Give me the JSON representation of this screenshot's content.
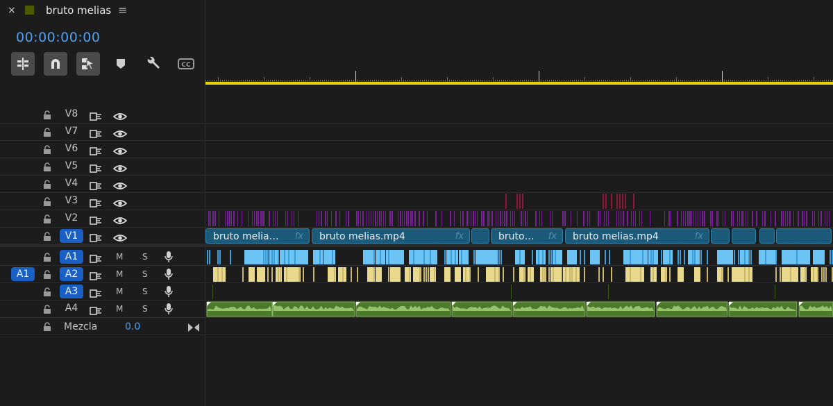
{
  "tab": {
    "close": "×",
    "title": "bruto melias",
    "menu": "≡",
    "swatch_color": "#4d5b00"
  },
  "timecode": "00:00:00:00",
  "toolbar": [
    {
      "name": "insert-nest-icon",
      "boxed": true
    },
    {
      "name": "snap-magnet-icon",
      "boxed": true
    },
    {
      "name": "linked-selection-icon",
      "boxed": true
    },
    {
      "name": "add-marker-icon",
      "boxed": false
    },
    {
      "name": "wrench-icon",
      "boxed": false
    },
    {
      "name": "captions-icon",
      "boxed": false
    }
  ],
  "tracks": {
    "video": [
      {
        "name": "V8",
        "source": "",
        "active": false
      },
      {
        "name": "V7",
        "source": "",
        "active": false
      },
      {
        "name": "V6",
        "source": "",
        "active": false
      },
      {
        "name": "V5",
        "source": "",
        "active": false
      },
      {
        "name": "V4",
        "source": "",
        "active": false
      },
      {
        "name": "V3",
        "source": "",
        "active": false
      },
      {
        "name": "V2",
        "source": "",
        "active": false
      },
      {
        "name": "V1",
        "source": "",
        "active": true
      }
    ],
    "audio": [
      {
        "name": "A1",
        "source": "",
        "active": true,
        "m": "M",
        "s": "S"
      },
      {
        "name": "A2",
        "source": "A1",
        "active": true,
        "m": "M",
        "s": "S"
      },
      {
        "name": "A3",
        "source": "",
        "active": true,
        "m": "M",
        "s": "S"
      },
      {
        "name": "A4",
        "source": "",
        "active": false,
        "m": "M",
        "s": "S"
      }
    ]
  },
  "mix": {
    "label": "Mezcla",
    "value": "0.0"
  },
  "v1_clips": [
    {
      "label": "bruto melia…",
      "fx": "fx"
    },
    {
      "label": "bruto melias.mp4",
      "fx": "fx"
    },
    {
      "label": "",
      "fx": ""
    },
    {
      "label": "bruto…",
      "fx": "fx"
    },
    {
      "label": "bruto melias.mp4",
      "fx": "fx"
    },
    {
      "label": "",
      "fx": ""
    },
    {
      "label": "",
      "fx": ""
    },
    {
      "label": "",
      "fx": ""
    },
    {
      "label": "",
      "fx": ""
    }
  ],
  "colors": {
    "accent_blue": "#4ea1f3",
    "active_track": "#1a5fc4",
    "ruler_yellow": "#e6d200",
    "v1_clip": "#1c5a79",
    "v2_clip": "#7a1f9a",
    "v3_clip": "#8a1a3a",
    "a1_clip": "#3a9ed8",
    "a2_clip": "#c9b86a",
    "a3_clip": "#3c5a22",
    "a4_clip": "#4c7a2a"
  }
}
